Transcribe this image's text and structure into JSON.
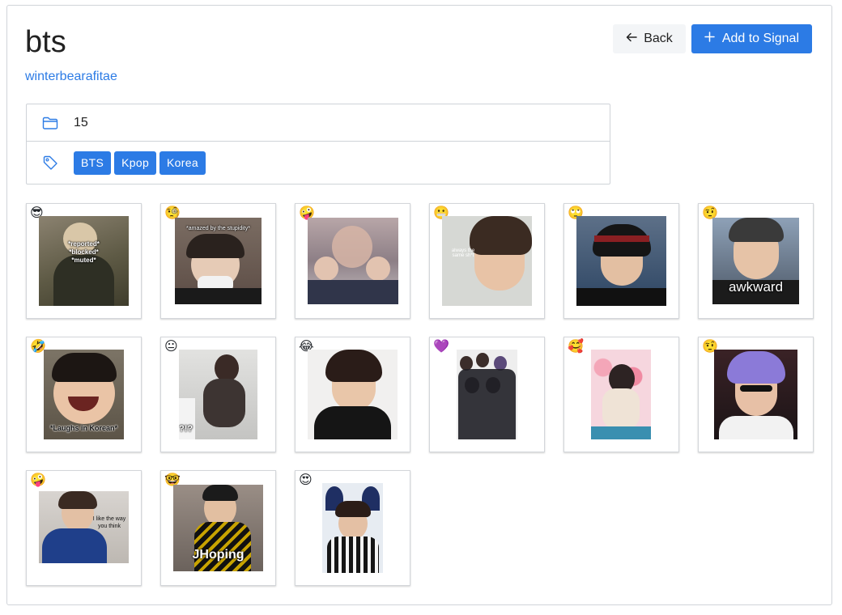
{
  "header": {
    "title": "bts",
    "author": "winterbearafitae",
    "back_label": "Back",
    "add_label": "Add to Signal"
  },
  "info": {
    "count": "15",
    "folder_icon": "folder-icon",
    "tag_icon": "tag-icon",
    "tags": [
      "BTS",
      "Kpop",
      "Korea"
    ]
  },
  "colors": {
    "accent": "#2c7be5",
    "border": "#cfd3d8",
    "back_bg": "#f3f5f7"
  },
  "stickers": [
    {
      "emoji": "😎",
      "caption": "*reported*\n*blocked*\n*muted*"
    },
    {
      "emoji": "🧐",
      "caption": "*amazed by the stupidity*"
    },
    {
      "emoji": "🤪",
      "caption": ""
    },
    {
      "emoji": "😬",
      "caption": "always the same sh*t"
    },
    {
      "emoji": "🙄",
      "caption": ""
    },
    {
      "emoji": "🤨",
      "caption": "awkward"
    },
    {
      "emoji": "🤣",
      "caption": "*Laughs in Korean*"
    },
    {
      "emoji": "😐",
      "caption": "?!?"
    },
    {
      "emoji": "😂",
      "caption": ""
    },
    {
      "emoji": "💜",
      "caption": ""
    },
    {
      "emoji": "🥰",
      "caption": ""
    },
    {
      "emoji": "🤨",
      "caption": ""
    },
    {
      "emoji": "🤪",
      "caption": "I like the way you think"
    },
    {
      "emoji": "🤓",
      "caption": "JHoping"
    },
    {
      "emoji": "😍",
      "caption": ""
    }
  ]
}
